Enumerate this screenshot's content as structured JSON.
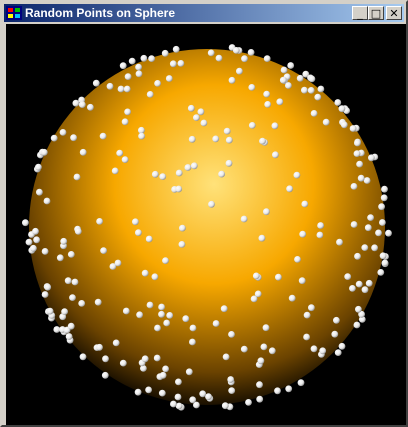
{
  "window": {
    "title": "Random Points on Sphere",
    "buttons": {
      "minimize": "_",
      "maximize": "□",
      "close": "✕"
    }
  },
  "scene": {
    "background": "#000000",
    "sphere_colors": {
      "highlight": "#ffe27a",
      "mid": "#f7a800",
      "dark": "#6b4300",
      "edge": "#1a1000"
    },
    "point_color": "#ffffff"
  },
  "icons": {
    "app": "app-window-icon"
  }
}
